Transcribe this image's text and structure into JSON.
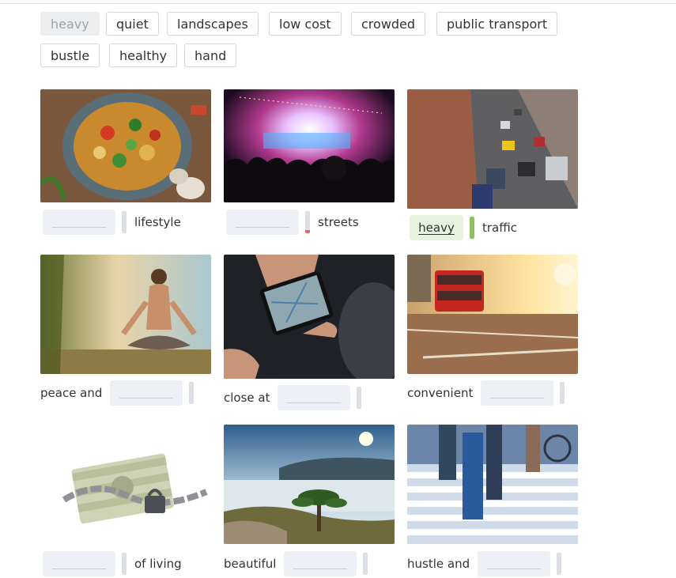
{
  "word_bank": [
    {
      "label": "heavy",
      "used": true
    },
    {
      "label": "quiet",
      "used": false
    },
    {
      "label": "landscapes",
      "used": false
    },
    {
      "label": "low cost",
      "used": false
    },
    {
      "label": "crowded",
      "used": false
    },
    {
      "label": "public transport",
      "used": false
    },
    {
      "label": "bustle",
      "used": false
    },
    {
      "label": "healthy",
      "used": false
    },
    {
      "label": "hand",
      "used": false
    }
  ],
  "cards": [
    {
      "image": "healthy-food-bowl",
      "before": "",
      "answer": "",
      "after": "lifestyle"
    },
    {
      "image": "concert-crowd",
      "before": "",
      "answer": "",
      "after": "streets"
    },
    {
      "image": "city-traffic",
      "before": "",
      "answer": "heavy",
      "after": "traffic"
    },
    {
      "image": "yoga-meditation",
      "before": "peace and",
      "answer": "",
      "after": ""
    },
    {
      "image": "phone-in-hand",
      "before": "close at",
      "answer": "",
      "after": ""
    },
    {
      "image": "red-bus-street",
      "before": "convenient",
      "answer": "",
      "after": ""
    },
    {
      "image": "money-chained",
      "before": "",
      "answer": "",
      "after": "of living"
    },
    {
      "image": "mountain-landscape",
      "before": "beautiful",
      "answer": "",
      "after": ""
    },
    {
      "image": "busy-crosswalk",
      "before": "hustle and",
      "answer": "",
      "after": ""
    }
  ],
  "colors": {
    "blank_bg": "#edf0f4",
    "filled_bg": "#e7f3df",
    "correct_bar": "#8fc15e",
    "wrong_marker": "#e06565",
    "chip_border": "#d7d7d7"
  }
}
